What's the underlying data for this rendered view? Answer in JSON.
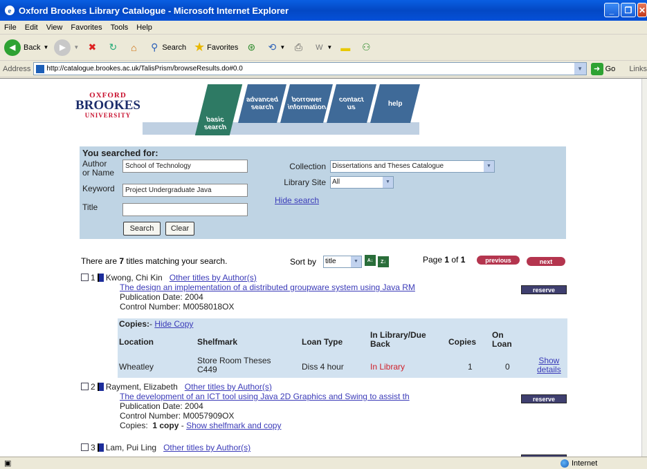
{
  "window": {
    "title": "Oxford Brookes Library Catalogue - Microsoft Internet Explorer"
  },
  "menu": [
    "File",
    "Edit",
    "View",
    "Favorites",
    "Tools",
    "Help"
  ],
  "toolbar": {
    "back": "Back",
    "search": "Search",
    "favorites": "Favorites"
  },
  "address": {
    "label": "Address",
    "url": "http://catalogue.brookes.ac.uk/TalisPrism/browseResults.do#0.0",
    "go": "Go",
    "links": "Links"
  },
  "logo": {
    "line1": "OXFORD",
    "line2": "BROOKES",
    "line3": "UNIVERSITY"
  },
  "nav": {
    "basic": [
      "basic",
      "search"
    ],
    "advanced": [
      "advanced",
      "search"
    ],
    "borrower": [
      "borrower",
      "information"
    ],
    "contact": [
      "contact",
      "us"
    ],
    "help": "help"
  },
  "search": {
    "title": "You searched for:",
    "author_label": [
      "Author",
      "or Name"
    ],
    "author_value": "School of Technology",
    "keyword_label": "Keyword",
    "keyword_value": "Project Undergraduate Java",
    "title_label": "Title",
    "title_value": "",
    "collection_label": "Collection",
    "collection_value": "Dissertations and Theses Catalogue",
    "site_label": "Library Site",
    "site_value": "All",
    "hide": "Hide search",
    "search_btn": "Search",
    "clear_btn": "Clear"
  },
  "results": {
    "count_pre": "There are ",
    "count": "7",
    "count_post": " titles matching your search.",
    "sort_label": "Sort by",
    "sort_value": "title",
    "page_pre": "Page ",
    "page": "1",
    "page_mid": " of ",
    "pages": "1",
    "previous": "previous",
    "next": "next"
  },
  "records": [
    {
      "num": "1",
      "author": "Kwong, Chi Kin",
      "other": "Other titles by Author(s)",
      "title": "The design an implementation of a distributed groupware system using Java RM",
      "pubdate": "Publication Date: 2004",
      "control": "Control Number: M0058018OX",
      "reserve": "reserve"
    },
    {
      "num": "2",
      "author": "Rayment, Elizabeth",
      "other": "Other titles by Author(s)",
      "title": "The development of an ICT tool using Java 2D Graphics and Swing to assist th",
      "pubdate": "Publication Date: 2004",
      "control": "Control Number: M0057909OX",
      "copies_pre": "Copies: ",
      "copies_count": "1 copy",
      "copies_sep": " - ",
      "copies_link": "Show shelfmark and copy",
      "reserve": "reserve"
    },
    {
      "num": "3",
      "author": "Lam, Pui Ling",
      "other": "Other titles by Author(s)"
    }
  ],
  "copies": {
    "label": "Copies:",
    "sep": "- ",
    "hide": "Hide Copy",
    "headers": {
      "location": "Location",
      "shelfmark": "Shelfmark",
      "loantype": "Loan Type",
      "inlib": [
        "In Library/Due",
        "Back"
      ],
      "copies": "Copies",
      "onloan": [
        "On",
        "Loan"
      ]
    },
    "row": {
      "location": "Wheatley",
      "shelfmark": [
        "Store Room Theses",
        "C449"
      ],
      "loantype": "Diss 4 hour",
      "inlib": "In Library",
      "copies": "1",
      "onloan": "0",
      "details": [
        "Show",
        "details"
      ]
    }
  },
  "status": {
    "zone": "Internet"
  }
}
